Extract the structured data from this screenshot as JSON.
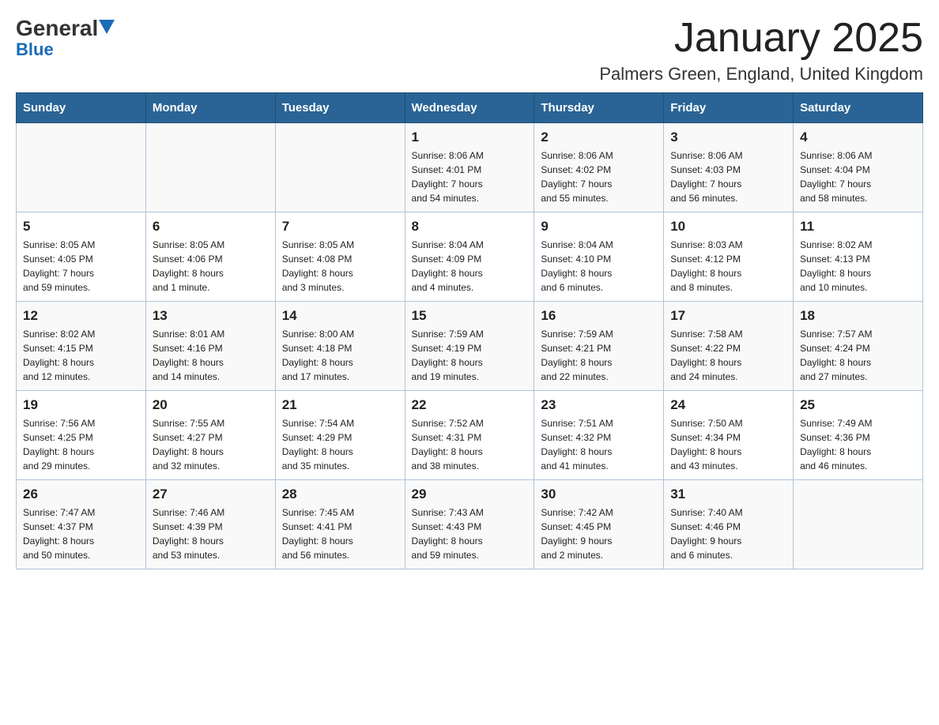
{
  "header": {
    "logo_general": "General",
    "logo_blue": "Blue",
    "month_title": "January 2025",
    "location": "Palmers Green, England, United Kingdom"
  },
  "days_of_week": [
    "Sunday",
    "Monday",
    "Tuesday",
    "Wednesday",
    "Thursday",
    "Friday",
    "Saturday"
  ],
  "weeks": [
    [
      {
        "num": "",
        "info": ""
      },
      {
        "num": "",
        "info": ""
      },
      {
        "num": "",
        "info": ""
      },
      {
        "num": "1",
        "info": "Sunrise: 8:06 AM\nSunset: 4:01 PM\nDaylight: 7 hours\nand 54 minutes."
      },
      {
        "num": "2",
        "info": "Sunrise: 8:06 AM\nSunset: 4:02 PM\nDaylight: 7 hours\nand 55 minutes."
      },
      {
        "num": "3",
        "info": "Sunrise: 8:06 AM\nSunset: 4:03 PM\nDaylight: 7 hours\nand 56 minutes."
      },
      {
        "num": "4",
        "info": "Sunrise: 8:06 AM\nSunset: 4:04 PM\nDaylight: 7 hours\nand 58 minutes."
      }
    ],
    [
      {
        "num": "5",
        "info": "Sunrise: 8:05 AM\nSunset: 4:05 PM\nDaylight: 7 hours\nand 59 minutes."
      },
      {
        "num": "6",
        "info": "Sunrise: 8:05 AM\nSunset: 4:06 PM\nDaylight: 8 hours\nand 1 minute."
      },
      {
        "num": "7",
        "info": "Sunrise: 8:05 AM\nSunset: 4:08 PM\nDaylight: 8 hours\nand 3 minutes."
      },
      {
        "num": "8",
        "info": "Sunrise: 8:04 AM\nSunset: 4:09 PM\nDaylight: 8 hours\nand 4 minutes."
      },
      {
        "num": "9",
        "info": "Sunrise: 8:04 AM\nSunset: 4:10 PM\nDaylight: 8 hours\nand 6 minutes."
      },
      {
        "num": "10",
        "info": "Sunrise: 8:03 AM\nSunset: 4:12 PM\nDaylight: 8 hours\nand 8 minutes."
      },
      {
        "num": "11",
        "info": "Sunrise: 8:02 AM\nSunset: 4:13 PM\nDaylight: 8 hours\nand 10 minutes."
      }
    ],
    [
      {
        "num": "12",
        "info": "Sunrise: 8:02 AM\nSunset: 4:15 PM\nDaylight: 8 hours\nand 12 minutes."
      },
      {
        "num": "13",
        "info": "Sunrise: 8:01 AM\nSunset: 4:16 PM\nDaylight: 8 hours\nand 14 minutes."
      },
      {
        "num": "14",
        "info": "Sunrise: 8:00 AM\nSunset: 4:18 PM\nDaylight: 8 hours\nand 17 minutes."
      },
      {
        "num": "15",
        "info": "Sunrise: 7:59 AM\nSunset: 4:19 PM\nDaylight: 8 hours\nand 19 minutes."
      },
      {
        "num": "16",
        "info": "Sunrise: 7:59 AM\nSunset: 4:21 PM\nDaylight: 8 hours\nand 22 minutes."
      },
      {
        "num": "17",
        "info": "Sunrise: 7:58 AM\nSunset: 4:22 PM\nDaylight: 8 hours\nand 24 minutes."
      },
      {
        "num": "18",
        "info": "Sunrise: 7:57 AM\nSunset: 4:24 PM\nDaylight: 8 hours\nand 27 minutes."
      }
    ],
    [
      {
        "num": "19",
        "info": "Sunrise: 7:56 AM\nSunset: 4:25 PM\nDaylight: 8 hours\nand 29 minutes."
      },
      {
        "num": "20",
        "info": "Sunrise: 7:55 AM\nSunset: 4:27 PM\nDaylight: 8 hours\nand 32 minutes."
      },
      {
        "num": "21",
        "info": "Sunrise: 7:54 AM\nSunset: 4:29 PM\nDaylight: 8 hours\nand 35 minutes."
      },
      {
        "num": "22",
        "info": "Sunrise: 7:52 AM\nSunset: 4:31 PM\nDaylight: 8 hours\nand 38 minutes."
      },
      {
        "num": "23",
        "info": "Sunrise: 7:51 AM\nSunset: 4:32 PM\nDaylight: 8 hours\nand 41 minutes."
      },
      {
        "num": "24",
        "info": "Sunrise: 7:50 AM\nSunset: 4:34 PM\nDaylight: 8 hours\nand 43 minutes."
      },
      {
        "num": "25",
        "info": "Sunrise: 7:49 AM\nSunset: 4:36 PM\nDaylight: 8 hours\nand 46 minutes."
      }
    ],
    [
      {
        "num": "26",
        "info": "Sunrise: 7:47 AM\nSunset: 4:37 PM\nDaylight: 8 hours\nand 50 minutes."
      },
      {
        "num": "27",
        "info": "Sunrise: 7:46 AM\nSunset: 4:39 PM\nDaylight: 8 hours\nand 53 minutes."
      },
      {
        "num": "28",
        "info": "Sunrise: 7:45 AM\nSunset: 4:41 PM\nDaylight: 8 hours\nand 56 minutes."
      },
      {
        "num": "29",
        "info": "Sunrise: 7:43 AM\nSunset: 4:43 PM\nDaylight: 8 hours\nand 59 minutes."
      },
      {
        "num": "30",
        "info": "Sunrise: 7:42 AM\nSunset: 4:45 PM\nDaylight: 9 hours\nand 2 minutes."
      },
      {
        "num": "31",
        "info": "Sunrise: 7:40 AM\nSunset: 4:46 PM\nDaylight: 9 hours\nand 6 minutes."
      },
      {
        "num": "",
        "info": ""
      }
    ]
  ]
}
